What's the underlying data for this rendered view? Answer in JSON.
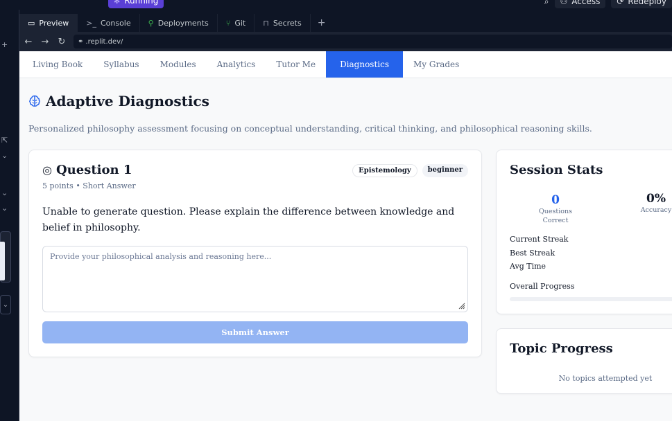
{
  "ide": {
    "run_status": "Running",
    "access_label": "Access",
    "redeploy_label": "Redeploy",
    "tabs": [
      {
        "label": "Preview",
        "icon": "monitor-icon",
        "glyph": "▭"
      },
      {
        "label": "Console",
        "icon": "terminal-icon",
        "glyph": ">_"
      },
      {
        "label": "Deployments",
        "icon": "deploy-icon",
        "glyph": "⚲"
      },
      {
        "label": "Git",
        "icon": "git-icon",
        "glyph": "⑂"
      },
      {
        "label": "Secrets",
        "icon": "lock-icon",
        "glyph": "🔒"
      }
    ],
    "url": ".replit.dev/"
  },
  "app": {
    "nav": [
      "Living Book",
      "Syllabus",
      "Modules",
      "Analytics",
      "Tutor Me",
      "Diagnostics",
      "My Grades"
    ],
    "active_nav": 5,
    "title": "Adaptive Diagnostics",
    "subtitle": "Personalized philosophy assessment focusing on conceptual understanding, critical thinking, and philosophical reasoning skills.",
    "question": {
      "heading": "Question 1",
      "meta": "5 points • Short Answer",
      "badges": [
        "Epistemology",
        "beginner"
      ],
      "text": "Unable to generate question. Please explain the difference between knowledge and belief in philosophy.",
      "placeholder": "Provide your philosophical analysis and reasoning here...",
      "submit_label": "Submit Answer"
    },
    "stats": {
      "heading": "Session Stats",
      "correct": "0",
      "correct_label": "Questions Correct",
      "accuracy": "0%",
      "accuracy_label": "Accuracy",
      "current_streak_label": "Current Streak",
      "best_streak_label": "Best Streak",
      "avg_time_label": "Avg Time",
      "overall_progress_label": "Overall Progress",
      "overall_progress": 0
    },
    "topics": {
      "heading": "Topic Progress",
      "empty": "No topics attempted yet"
    }
  },
  "colors": {
    "accent": "#2563eb",
    "run_pill": "#5a3fd6",
    "ide_bg": "#0e1525"
  }
}
